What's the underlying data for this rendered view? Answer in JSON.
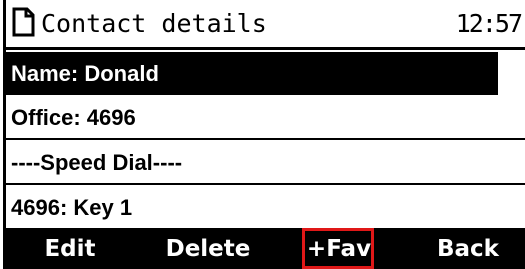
{
  "header": {
    "title": "Contact details",
    "time": "12:57"
  },
  "rows": [
    {
      "label": "Name: Donald",
      "selected": true
    },
    {
      "label": "Office: 4696",
      "selected": false
    },
    {
      "label": "----Speed Dial----",
      "selected": false
    },
    {
      "label": "4696: Key 1",
      "selected": false
    }
  ],
  "softkeys": {
    "edit": "Edit",
    "delete": "Delete",
    "fav": "+Fav",
    "back": "Back"
  },
  "colors": {
    "background": "#ffffff",
    "foreground": "#000000",
    "selection": "#000000",
    "highlight_box": "#e01818"
  },
  "icons": {
    "header_icon": "contact-card-icon"
  },
  "highlighted_softkey": "+Fav"
}
